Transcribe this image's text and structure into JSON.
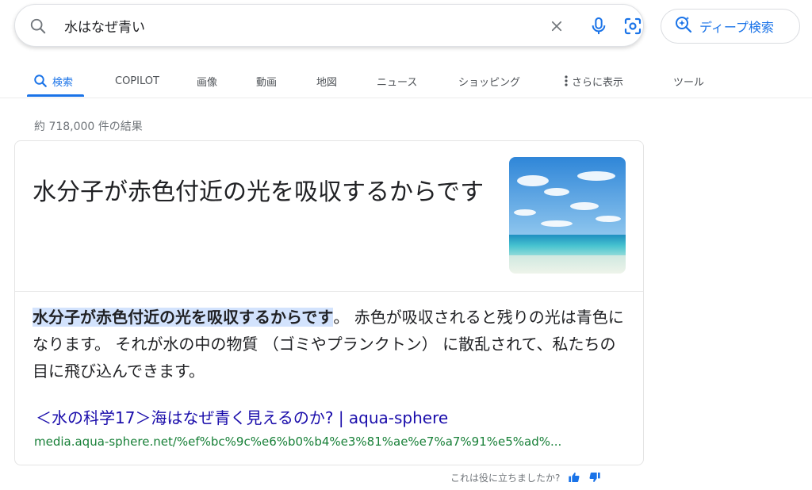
{
  "search": {
    "query": "水はなぜ青い",
    "deep_search_label": "ディープ検索"
  },
  "tabs": [
    {
      "label": "検索",
      "active": true
    },
    {
      "label": "COPILOT"
    },
    {
      "label": "画像"
    },
    {
      "label": "動画"
    },
    {
      "label": "地図"
    },
    {
      "label": "ニュース"
    },
    {
      "label": "ショッピング"
    },
    {
      "label": "さらに表示"
    },
    {
      "label": "ツール"
    }
  ],
  "results": {
    "count_text": "約 718,000 件の結果"
  },
  "featured_answer": {
    "title": "水分子が赤色付近の光を吸収するからです",
    "snippet_highlight": "水分子が赤色付近の光を吸収するからです",
    "snippet_rest": "。 赤色が吸収されると残りの光は青色になります。 それが水の中の物質 （ゴミやプランクトン） に散乱されて、私たちの目に飛び込んできます。",
    "source_title": "＜水の科学17＞海はなぜ青く見えるのか? | aqua-sphere",
    "source_url": "media.aqua-sphere.net/%ef%bc%9c%e6%b0%b4%e3%81%ae%e7%a7%91%e5%ad%..."
  },
  "feedback": {
    "prompt": "これは役に立ちましたか?"
  },
  "colors": {
    "accent": "#1a73e8",
    "link": "#1a0dab",
    "url": "#188038",
    "highlight": "#d3e3fd"
  }
}
